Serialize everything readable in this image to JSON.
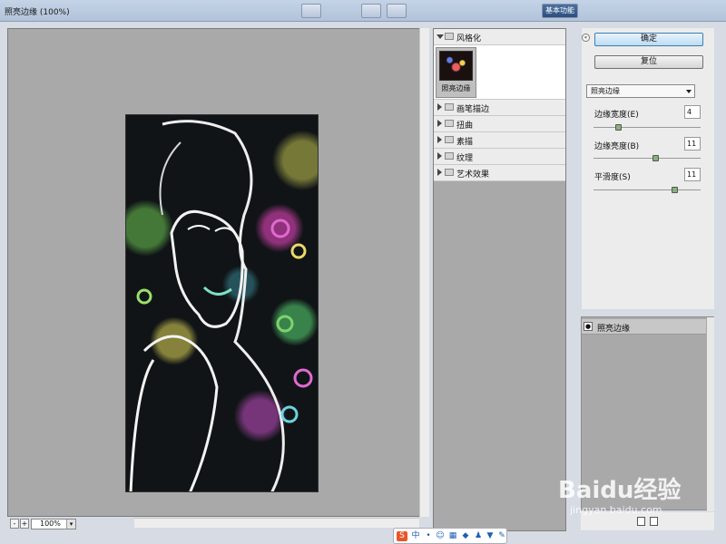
{
  "window": {
    "title": "照亮边缘 (100%)"
  },
  "toolbar": {
    "workspace_button": "基本功能"
  },
  "preview": {
    "zoom_minus": "-",
    "zoom_plus": "+",
    "zoom_value": "100%"
  },
  "filters": {
    "open_group": "风格化",
    "selected_thumb_label": "照亮边缘",
    "groups": [
      "画笔描边",
      "扭曲",
      "素描",
      "纹理",
      "艺术效果"
    ]
  },
  "settings": {
    "ok_label": "确定",
    "reset_label": "复位",
    "filter_select": "照亮边缘",
    "params": [
      {
        "label": "边缘宽度(E)",
        "value": "4",
        "level": 0.2
      },
      {
        "label": "边缘亮度(B)",
        "value": "11",
        "level": 0.55
      },
      {
        "label": "平滑度(S)",
        "value": "11",
        "level": 0.73
      }
    ]
  },
  "layers": {
    "item": "照亮边缘"
  },
  "watermark": {
    "brand": "Baidu经验",
    "url": "jingyan.baidu.com"
  },
  "ime": {
    "lang": "中"
  },
  "colors": {
    "primary_button": "#bcdcf3",
    "panel_gray": "#a9a9a9"
  }
}
